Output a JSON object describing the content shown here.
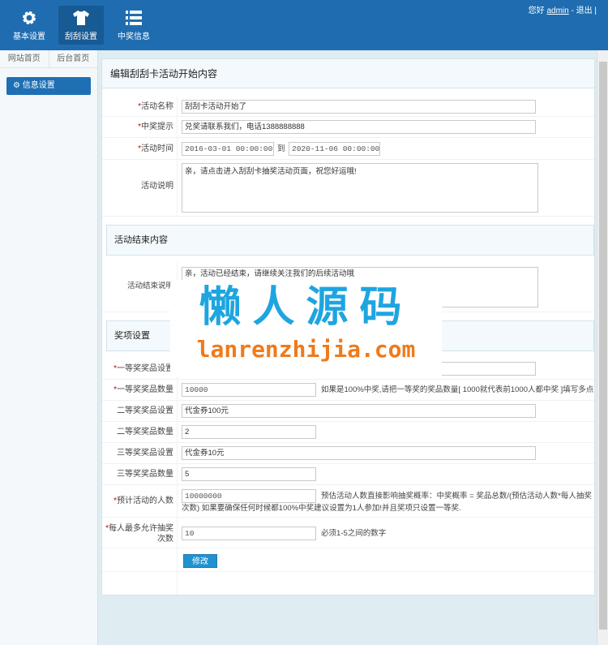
{
  "header": {
    "nav": [
      {
        "label": "基本设置",
        "icon": "gear-icon"
      },
      {
        "label": "刮刮设置",
        "icon": "shirt-icon"
      },
      {
        "label": "中奖信息",
        "icon": "list-icon"
      }
    ],
    "greeting": "您好",
    "user": "admin",
    "sep": "-",
    "logout": "退出",
    "bar": "|"
  },
  "sidebar": {
    "tabs": [
      "网站首页",
      "后台首页"
    ],
    "item": "信息设置"
  },
  "main": {
    "title": "编辑刮刮卡活动开始内容",
    "name": {
      "label": "活动名称",
      "value": "刮刮卡活动开始了"
    },
    "tip": {
      "label": "中奖提示",
      "value": "兑奖请联系我们，电话1388888888"
    },
    "time": {
      "label": "活动时间",
      "start": "2016-03-01 00:00:00",
      "to": "到",
      "end": "2020-11-06 00:00:00"
    },
    "desc": {
      "label": "活动说明",
      "value": "亲，请点击进入刮刮卡抽奖活动页面，祝您好运哦!"
    },
    "end_title": "活动结束内容",
    "end_desc": {
      "label": "活动结束说明",
      "value": "亲，活动已经结束，请继续关注我们的后续活动哦"
    },
    "prize_title": "奖项设置",
    "prizes": [
      {
        "label": "一等奖奖品设置",
        "value": "",
        "req": true,
        "wide": true
      },
      {
        "label": "一等奖奖品数量",
        "value": "10000",
        "req": true,
        "hint": "如果是100%中奖,请把一等奖的奖品数量[ 1000就代表前1000人都中奖 ]填写多点"
      },
      {
        "label": "二等奖奖品设置",
        "value": "代金券100元",
        "wide": true
      },
      {
        "label": "二等奖奖品数量",
        "value": "2"
      },
      {
        "label": "三等奖奖品设置",
        "value": "代金券10元",
        "wide": true
      },
      {
        "label": "三等奖奖品数量",
        "value": "5"
      }
    ],
    "people": {
      "label": "预计活动的人数",
      "value": "10000000",
      "hint1": "预估活动人数直接影响抽奖概率：中奖概率 = 奖品总数/(预估活动人数*每人抽奖",
      "hint2": "次数) 如果要确保任何时候都100%中奖建议设置为1人参加!并且奖项只设置一等奖."
    },
    "max": {
      "label1": "每人最多允许抽奖",
      "label2": "次数",
      "value": "10",
      "hint": "必须1-5之间的数字"
    },
    "submit": "修改"
  },
  "watermark": {
    "cn": "懒人源码",
    "url": "lanrenzhijia.com"
  }
}
